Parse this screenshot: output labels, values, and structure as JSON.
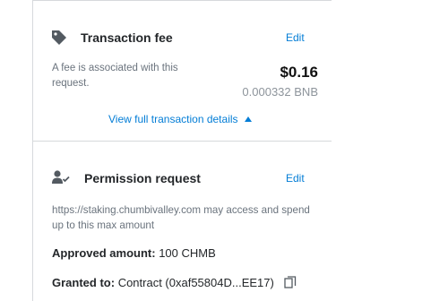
{
  "fee": {
    "title": "Transaction fee",
    "edit_label": "Edit",
    "description": "A fee is associated with this request.",
    "amount": "$0.16",
    "native_amount": "0.000332 BNB",
    "view_details_label": "View full transaction details"
  },
  "permission": {
    "title": "Permission request",
    "edit_label": "Edit",
    "description": "https://staking.chumbivalley.com may access and spend up to this max amount",
    "approved_label": "Approved amount:",
    "approved_value": "100 CHMB",
    "granted_label": "Granted to:",
    "granted_value": "Contract (0xaf55804D...EE17)"
  },
  "icons": {
    "fee": "tag-icon",
    "permission": "user-check-icon",
    "copy": "copy-icon",
    "expand": "caret-up-icon"
  },
  "colors": {
    "link": "#037dd6",
    "text": "#24272a",
    "muted": "#6a737d",
    "divider": "#d6d9dc"
  }
}
